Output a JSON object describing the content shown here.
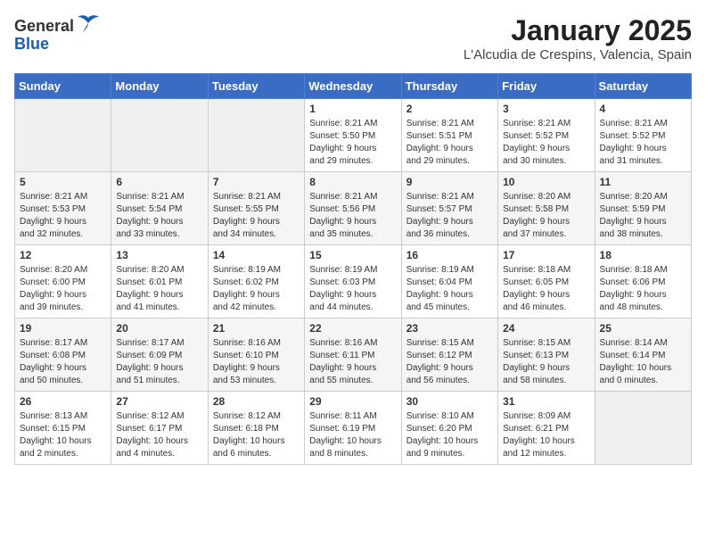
{
  "header": {
    "logo": {
      "general": "General",
      "blue": "Blue"
    },
    "title": "January 2025",
    "location": "L'Alcudia de Crespins, Valencia, Spain"
  },
  "calendar": {
    "days_of_week": [
      "Sunday",
      "Monday",
      "Tuesday",
      "Wednesday",
      "Thursday",
      "Friday",
      "Saturday"
    ],
    "weeks": [
      [
        {
          "day": "",
          "info": ""
        },
        {
          "day": "",
          "info": ""
        },
        {
          "day": "",
          "info": ""
        },
        {
          "day": "1",
          "info": "Sunrise: 8:21 AM\nSunset: 5:50 PM\nDaylight: 9 hours\nand 29 minutes."
        },
        {
          "day": "2",
          "info": "Sunrise: 8:21 AM\nSunset: 5:51 PM\nDaylight: 9 hours\nand 29 minutes."
        },
        {
          "day": "3",
          "info": "Sunrise: 8:21 AM\nSunset: 5:52 PM\nDaylight: 9 hours\nand 30 minutes."
        },
        {
          "day": "4",
          "info": "Sunrise: 8:21 AM\nSunset: 5:52 PM\nDaylight: 9 hours\nand 31 minutes."
        }
      ],
      [
        {
          "day": "5",
          "info": "Sunrise: 8:21 AM\nSunset: 5:53 PM\nDaylight: 9 hours\nand 32 minutes."
        },
        {
          "day": "6",
          "info": "Sunrise: 8:21 AM\nSunset: 5:54 PM\nDaylight: 9 hours\nand 33 minutes."
        },
        {
          "day": "7",
          "info": "Sunrise: 8:21 AM\nSunset: 5:55 PM\nDaylight: 9 hours\nand 34 minutes."
        },
        {
          "day": "8",
          "info": "Sunrise: 8:21 AM\nSunset: 5:56 PM\nDaylight: 9 hours\nand 35 minutes."
        },
        {
          "day": "9",
          "info": "Sunrise: 8:21 AM\nSunset: 5:57 PM\nDaylight: 9 hours\nand 36 minutes."
        },
        {
          "day": "10",
          "info": "Sunrise: 8:20 AM\nSunset: 5:58 PM\nDaylight: 9 hours\nand 37 minutes."
        },
        {
          "day": "11",
          "info": "Sunrise: 8:20 AM\nSunset: 5:59 PM\nDaylight: 9 hours\nand 38 minutes."
        }
      ],
      [
        {
          "day": "12",
          "info": "Sunrise: 8:20 AM\nSunset: 6:00 PM\nDaylight: 9 hours\nand 39 minutes."
        },
        {
          "day": "13",
          "info": "Sunrise: 8:20 AM\nSunset: 6:01 PM\nDaylight: 9 hours\nand 41 minutes."
        },
        {
          "day": "14",
          "info": "Sunrise: 8:19 AM\nSunset: 6:02 PM\nDaylight: 9 hours\nand 42 minutes."
        },
        {
          "day": "15",
          "info": "Sunrise: 8:19 AM\nSunset: 6:03 PM\nDaylight: 9 hours\nand 44 minutes."
        },
        {
          "day": "16",
          "info": "Sunrise: 8:19 AM\nSunset: 6:04 PM\nDaylight: 9 hours\nand 45 minutes."
        },
        {
          "day": "17",
          "info": "Sunrise: 8:18 AM\nSunset: 6:05 PM\nDaylight: 9 hours\nand 46 minutes."
        },
        {
          "day": "18",
          "info": "Sunrise: 8:18 AM\nSunset: 6:06 PM\nDaylight: 9 hours\nand 48 minutes."
        }
      ],
      [
        {
          "day": "19",
          "info": "Sunrise: 8:17 AM\nSunset: 6:08 PM\nDaylight: 9 hours\nand 50 minutes."
        },
        {
          "day": "20",
          "info": "Sunrise: 8:17 AM\nSunset: 6:09 PM\nDaylight: 9 hours\nand 51 minutes."
        },
        {
          "day": "21",
          "info": "Sunrise: 8:16 AM\nSunset: 6:10 PM\nDaylight: 9 hours\nand 53 minutes."
        },
        {
          "day": "22",
          "info": "Sunrise: 8:16 AM\nSunset: 6:11 PM\nDaylight: 9 hours\nand 55 minutes."
        },
        {
          "day": "23",
          "info": "Sunrise: 8:15 AM\nSunset: 6:12 PM\nDaylight: 9 hours\nand 56 minutes."
        },
        {
          "day": "24",
          "info": "Sunrise: 8:15 AM\nSunset: 6:13 PM\nDaylight: 9 hours\nand 58 minutes."
        },
        {
          "day": "25",
          "info": "Sunrise: 8:14 AM\nSunset: 6:14 PM\nDaylight: 10 hours\nand 0 minutes."
        }
      ],
      [
        {
          "day": "26",
          "info": "Sunrise: 8:13 AM\nSunset: 6:15 PM\nDaylight: 10 hours\nand 2 minutes."
        },
        {
          "day": "27",
          "info": "Sunrise: 8:12 AM\nSunset: 6:17 PM\nDaylight: 10 hours\nand 4 minutes."
        },
        {
          "day": "28",
          "info": "Sunrise: 8:12 AM\nSunset: 6:18 PM\nDaylight: 10 hours\nand 6 minutes."
        },
        {
          "day": "29",
          "info": "Sunrise: 8:11 AM\nSunset: 6:19 PM\nDaylight: 10 hours\nand 8 minutes."
        },
        {
          "day": "30",
          "info": "Sunrise: 8:10 AM\nSunset: 6:20 PM\nDaylight: 10 hours\nand 9 minutes."
        },
        {
          "day": "31",
          "info": "Sunrise: 8:09 AM\nSunset: 6:21 PM\nDaylight: 10 hours\nand 12 minutes."
        },
        {
          "day": "",
          "info": ""
        }
      ]
    ]
  }
}
